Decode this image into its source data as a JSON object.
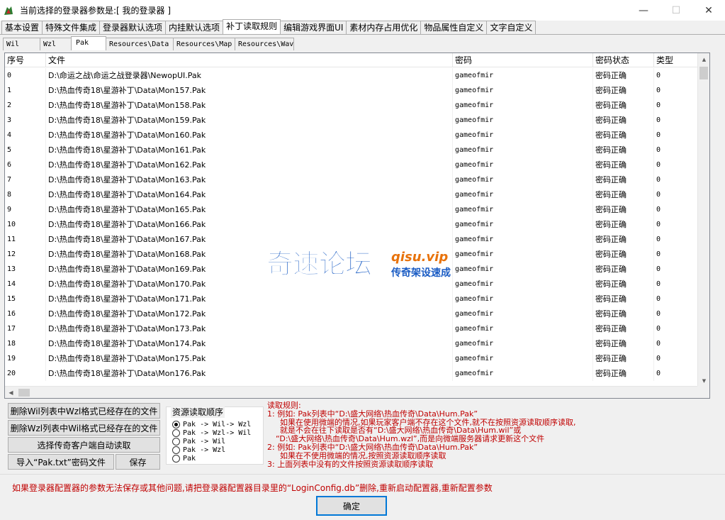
{
  "window": {
    "title": "当前选择的登录器参数是:[ 我的登录器 ]",
    "minimize": "—",
    "maximize": "☐",
    "close": "✕"
  },
  "main_tabs": [
    {
      "label": "基本设置",
      "active": false
    },
    {
      "label": "特殊文件集成",
      "active": false
    },
    {
      "label": "登录器默认选项",
      "active": false
    },
    {
      "label": "内挂默认选项",
      "active": false
    },
    {
      "label": "补丁读取规则",
      "active": true
    },
    {
      "label": "编辑游戏界面UI",
      "active": false
    },
    {
      "label": "素材内存占用优化",
      "active": false
    },
    {
      "label": "物品属性自定义",
      "active": false
    },
    {
      "label": "文字自定义",
      "active": false
    }
  ],
  "sub_tabs": [
    {
      "label": "Wil",
      "active": false
    },
    {
      "label": "Wzl",
      "active": false
    },
    {
      "label": "Pak",
      "active": true
    },
    {
      "label": "Resources\\Data",
      "active": false
    },
    {
      "label": "Resources\\Map",
      "active": false
    },
    {
      "label": "Resources\\Wav",
      "active": false
    }
  ],
  "table": {
    "columns": [
      "序号",
      "文件",
      "密码",
      "密码状态",
      "类型"
    ],
    "rows": [
      [
        "0",
        "D:\\命运之战\\命运之战登录器\\NewopUI.Pak",
        "gameofmir",
        "密码正确",
        "0"
      ],
      [
        "1",
        "D:\\热血传奇18\\星游补丁\\Data\\Mon157.Pak",
        "gameofmir",
        "密码正确",
        "0"
      ],
      [
        "2",
        "D:\\热血传奇18\\星游补丁\\Data\\Mon158.Pak",
        "gameofmir",
        "密码正确",
        "0"
      ],
      [
        "3",
        "D:\\热血传奇18\\星游补丁\\Data\\Mon159.Pak",
        "gameofmir",
        "密码正确",
        "0"
      ],
      [
        "4",
        "D:\\热血传奇18\\星游补丁\\Data\\Mon160.Pak",
        "gameofmir",
        "密码正确",
        "0"
      ],
      [
        "5",
        "D:\\热血传奇18\\星游补丁\\Data\\Mon161.Pak",
        "gameofmir",
        "密码正确",
        "0"
      ],
      [
        "6",
        "D:\\热血传奇18\\星游补丁\\Data\\Mon162.Pak",
        "gameofmir",
        "密码正确",
        "0"
      ],
      [
        "7",
        "D:\\热血传奇18\\星游补丁\\Data\\Mon163.Pak",
        "gameofmir",
        "密码正确",
        "0"
      ],
      [
        "8",
        "D:\\热血传奇18\\星游补丁\\Data\\Mon164.Pak",
        "gameofmir",
        "密码正确",
        "0"
      ],
      [
        "9",
        "D:\\热血传奇18\\星游补丁\\Data\\Mon165.Pak",
        "gameofmir",
        "密码正确",
        "0"
      ],
      [
        "10",
        "D:\\热血传奇18\\星游补丁\\Data\\Mon166.Pak",
        "gameofmir",
        "密码正确",
        "0"
      ],
      [
        "11",
        "D:\\热血传奇18\\星游补丁\\Data\\Mon167.Pak",
        "gameofmir",
        "密码正确",
        "0"
      ],
      [
        "12",
        "D:\\热血传奇18\\星游补丁\\Data\\Mon168.Pak",
        "gameofmir",
        "密码正确",
        "0"
      ],
      [
        "13",
        "D:\\热血传奇18\\星游补丁\\Data\\Mon169.Pak",
        "gameofmir",
        "密码正确",
        "0"
      ],
      [
        "14",
        "D:\\热血传奇18\\星游补丁\\Data\\Mon170.Pak",
        "gameofmir",
        "密码正确",
        "0"
      ],
      [
        "15",
        "D:\\热血传奇18\\星游补丁\\Data\\Mon171.Pak",
        "gameofmir",
        "密码正确",
        "0"
      ],
      [
        "16",
        "D:\\热血传奇18\\星游补丁\\Data\\Mon172.Pak",
        "gameofmir",
        "密码正确",
        "0"
      ],
      [
        "17",
        "D:\\热血传奇18\\星游补丁\\Data\\Mon173.Pak",
        "gameofmir",
        "密码正确",
        "0"
      ],
      [
        "18",
        "D:\\热血传奇18\\星游补丁\\Data\\Mon174.Pak",
        "gameofmir",
        "密码正确",
        "0"
      ],
      [
        "19",
        "D:\\热血传奇18\\星游补丁\\Data\\Mon175.Pak",
        "gameofmir",
        "密码正确",
        "0"
      ],
      [
        "20",
        "D:\\热血传奇18\\星游补丁\\Data\\Mon176.Pak",
        "gameofmir",
        "密码正确",
        "0"
      ]
    ]
  },
  "watermark": {
    "cn": "奇速论坛",
    "url": "qisu.vip",
    "sub": "传奇架设速成"
  },
  "buttons": {
    "delete_wil": "删除Wil列表中Wzl格式已经存在的文件",
    "delete_wzl": "删除Wzl列表中Wil格式已经存在的文件",
    "auto_read": "选择传奇客户端自动读取",
    "import_pwd": "导入“Pak.txt”密码文件",
    "save": "保存",
    "ok": "确定"
  },
  "read_order": {
    "title": "资源读取顺序",
    "options": [
      {
        "label": "Pak -> Wil-> Wzl",
        "selected": true
      },
      {
        "label": "Pak -> Wzl-> Wil",
        "selected": false
      },
      {
        "label": "Pak -> Wil",
        "selected": false
      },
      {
        "label": "Pak -> Wzl",
        "selected": false
      },
      {
        "label": "Pak",
        "selected": false
      }
    ]
  },
  "rules": [
    "读取规则:",
    "1: 例如: Pak列表中“D:\\盛大网络\\热血传奇\\Data\\Hum.Pak”",
    "如果在使用微端的情况,如果玩家客户端不存在这个文件,就不在按照资源读取顺序读取,",
    "就是不会在往下读取是否有“D:\\盛大网络\\热血传奇\\Data\\Hum.wil”或",
    "“D:\\盛大网络\\热血传奇\\Data\\Hum.wzl”,而是向微端服务器请求更新这个文件",
    "2: 例如: Pak列表中“D:\\盛大网络\\热血传奇\\Data\\Hum.Pak”",
    "如果在不使用微端的情况,按照资源读取顺序读取",
    "3: 上面列表中没有的文件按照资源读取顺序读取"
  ],
  "footer_message": "如果登录器配置器的参数无法保存或其他问题,请把登录器配置器目录里的“LoginConfig.db”删除,重新启动配置器,重新配置参数",
  "colors": {
    "rules_text": "#c00000",
    "watermark_blue": "#1a5cc4",
    "watermark_orange": "#e8730c",
    "ok_border": "#0078d7"
  }
}
